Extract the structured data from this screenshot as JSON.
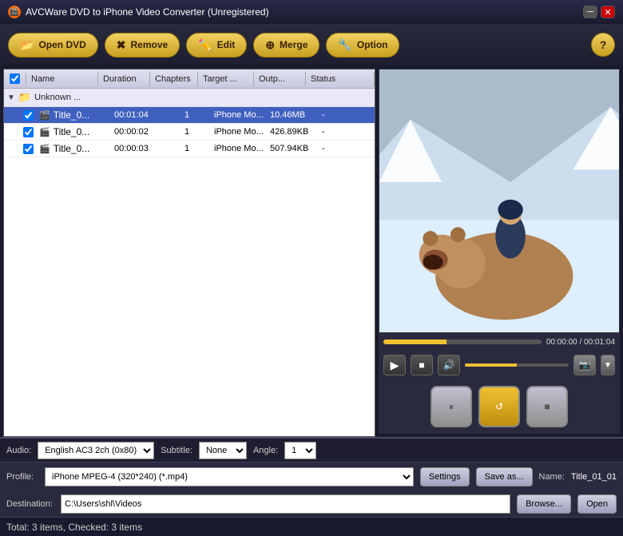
{
  "app": {
    "title": "AVCWare DVD to iPhone Video Converter (Unregistered)",
    "icon": "🎬"
  },
  "toolbar": {
    "open_dvd": "Open DVD",
    "remove": "Remove",
    "edit": "Edit",
    "merge": "Merge",
    "option": "Option",
    "help": "?"
  },
  "table": {
    "headers": {
      "name": "Name",
      "duration": "Duration",
      "chapters": "Chapters",
      "target": "Target ...",
      "output": "Outp...",
      "status": "Status"
    },
    "group": {
      "name": "Unknown ..."
    },
    "rows": [
      {
        "checked": true,
        "name": "Title_0...",
        "duration": "00:01:04",
        "chapters": "1",
        "target": "iPhone Mo...",
        "output": "10.46MB",
        "status": "-",
        "selected": true,
        "highlighted": true
      },
      {
        "checked": true,
        "name": "Title_0...",
        "duration": "00:00:02",
        "chapters": "1",
        "target": "iPhone Mo...",
        "output": "426.89KB",
        "status": "-",
        "selected": false
      },
      {
        "checked": true,
        "name": "Title_0...",
        "duration": "00:00:03",
        "chapters": "1",
        "target": "iPhone Mo...",
        "output": "507.94KB",
        "status": "-",
        "selected": false
      }
    ]
  },
  "preview": {
    "time_current": "00:00:00",
    "time_total": "00:01:04",
    "time_display": "00:00:00 / 00:01:04"
  },
  "audio": {
    "label": "Audio:",
    "value": "English AC3 2ch (0x80)",
    "subtitle_label": "Subtitle:",
    "subtitle_value": "None",
    "angle_label": "Angle:",
    "angle_value": "1"
  },
  "profile": {
    "label": "Profile:",
    "value": "iPhone MPEG-4 (320*240)  (*.mp4)",
    "settings_btn": "Settings",
    "saveas_btn": "Save as...",
    "name_label": "Name:",
    "name_value": "Title_01_01"
  },
  "destination": {
    "label": "Destination:",
    "value": "C:\\Users\\shl\\Videos",
    "browse_btn": "Browse...",
    "open_btn": "Open"
  },
  "status_bar": {
    "text": "Total: 3 items, Checked: 3 items"
  },
  "action_buttons": {
    "pause": "⏸",
    "reset": "↺",
    "stop": "■"
  }
}
